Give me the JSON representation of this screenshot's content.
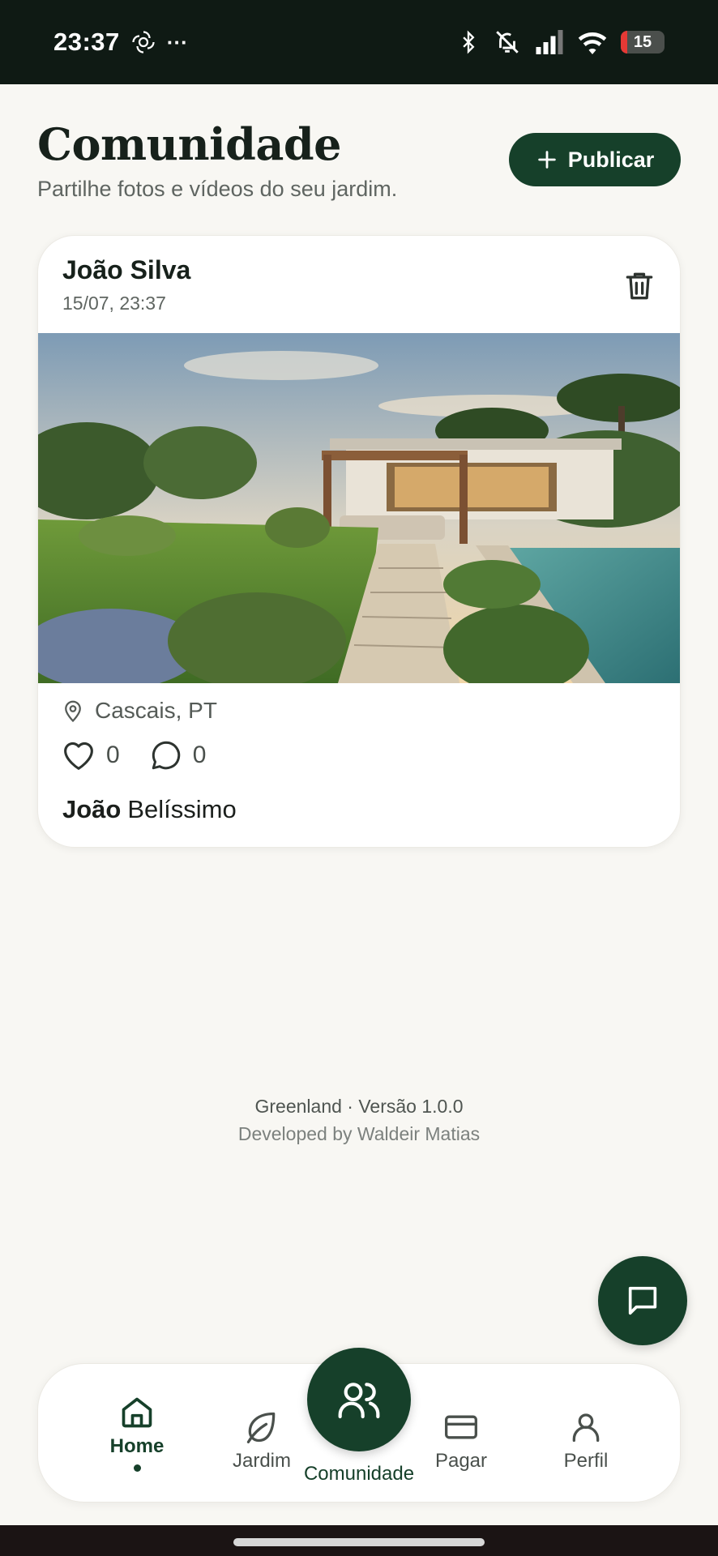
{
  "status_bar": {
    "time": "23:37",
    "overflow": "···",
    "battery_level": "15",
    "battery_fraction": 0.15,
    "icons": [
      "openai-icon",
      "bluetooth-icon",
      "bell-off-icon",
      "signal-icon",
      "wifi-icon",
      "battery-icon"
    ]
  },
  "header": {
    "title": "Comunidade",
    "subtitle": "Partilhe fotos e vídeos do seu jardim.",
    "publish_label": "Publicar"
  },
  "post": {
    "author": "João Silva",
    "date": "15/07, 23:37",
    "location": "Cascais, PT",
    "likes": "0",
    "comments": "0",
    "caption_author": "João",
    "caption_text": "Belíssimo"
  },
  "footer": {
    "version": "Greenland · Versão 1.0.0",
    "credit": "Developed by Waldeir Matias"
  },
  "bottom_nav": {
    "items": [
      {
        "label": "Home",
        "icon": "home-icon",
        "active": true
      },
      {
        "label": "Jardim",
        "icon": "leaf-icon"
      },
      {
        "label": "Comunidade",
        "icon": "users-icon"
      },
      {
        "label": "Pagar",
        "icon": "card-icon"
      },
      {
        "label": "Perfil",
        "icon": "user-icon"
      }
    ]
  },
  "colors": {
    "brand": "#16402a",
    "background": "#f8f7f3",
    "status_bar": "#0f1a14",
    "battery_low": "#e53935"
  }
}
